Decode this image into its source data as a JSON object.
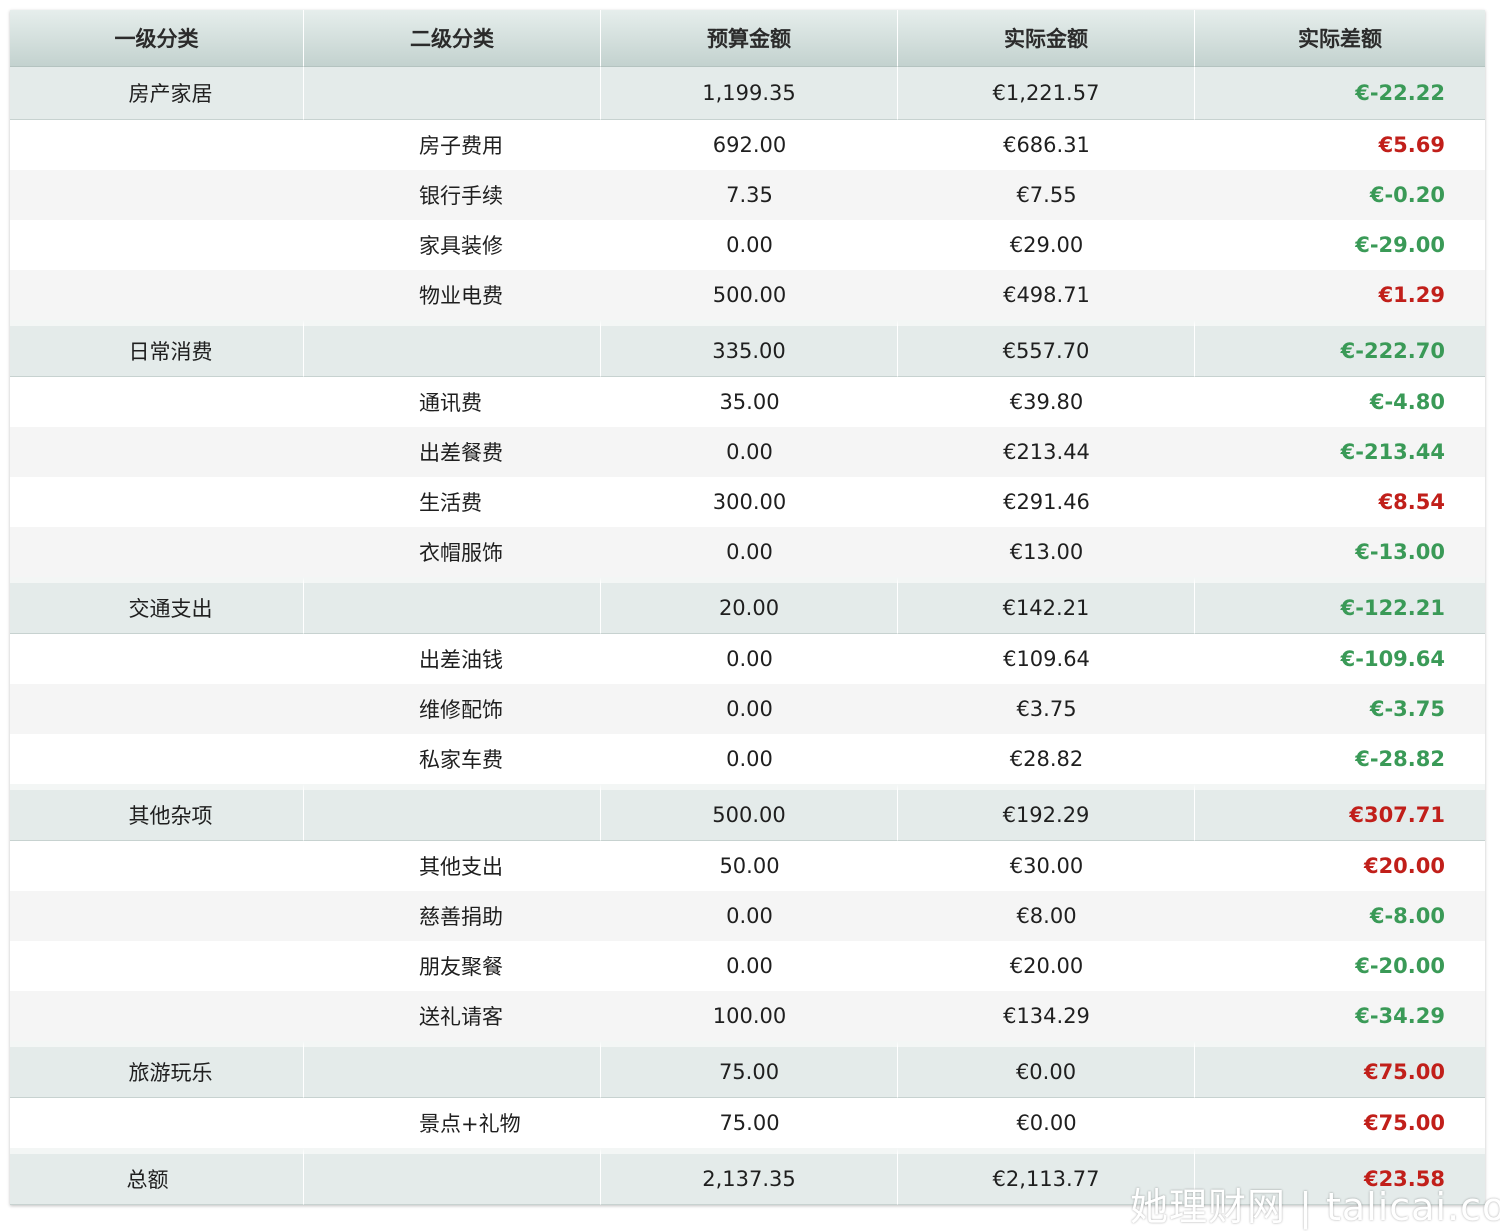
{
  "headers": [
    "一级分类",
    "二级分类",
    "预算金额",
    "实际金额",
    "实际差额"
  ],
  "groups": [
    {
      "name": "房产家居",
      "budget": "1,199.35",
      "actual": "€1,221.57",
      "diff": "€-22.22",
      "diff_sign": "neg",
      "items": [
        {
          "name": "房子费用",
          "budget": "692.00",
          "actual": "€686.31",
          "diff": "€5.69",
          "diff_sign": "pos"
        },
        {
          "name": "银行手续",
          "budget": "7.35",
          "actual": "€7.55",
          "diff": "€-0.20",
          "diff_sign": "neg"
        },
        {
          "name": "家具装修",
          "budget": "0.00",
          "actual": "€29.00",
          "diff": "€-29.00",
          "diff_sign": "neg"
        },
        {
          "name": "物业电费",
          "budget": "500.00",
          "actual": "€498.71",
          "diff": "€1.29",
          "diff_sign": "pos"
        }
      ]
    },
    {
      "name": "日常消费",
      "budget": "335.00",
      "actual": "€557.70",
      "diff": "€-222.70",
      "diff_sign": "neg",
      "items": [
        {
          "name": "通讯费",
          "budget": "35.00",
          "actual": "€39.80",
          "diff": "€-4.80",
          "diff_sign": "neg"
        },
        {
          "name": "出差餐费",
          "budget": "0.00",
          "actual": "€213.44",
          "diff": "€-213.44",
          "diff_sign": "neg"
        },
        {
          "name": "生活费",
          "budget": "300.00",
          "actual": "€291.46",
          "diff": "€8.54",
          "diff_sign": "pos"
        },
        {
          "name": "衣帽服饰",
          "budget": "0.00",
          "actual": "€13.00",
          "diff": "€-13.00",
          "diff_sign": "neg"
        }
      ]
    },
    {
      "name": "交通支出",
      "budget": "20.00",
      "actual": "€142.21",
      "diff": "€-122.21",
      "diff_sign": "neg",
      "items": [
        {
          "name": "出差油钱",
          "budget": "0.00",
          "actual": "€109.64",
          "diff": "€-109.64",
          "diff_sign": "neg"
        },
        {
          "name": "维修配饰",
          "budget": "0.00",
          "actual": "€3.75",
          "diff": "€-3.75",
          "diff_sign": "neg"
        },
        {
          "name": "私家车费",
          "budget": "0.00",
          "actual": "€28.82",
          "diff": "€-28.82",
          "diff_sign": "neg"
        }
      ]
    },
    {
      "name": "其他杂项",
      "budget": "500.00",
      "actual": "€192.29",
      "diff": "€307.71",
      "diff_sign": "pos",
      "items": [
        {
          "name": "其他支出",
          "budget": "50.00",
          "actual": "€30.00",
          "diff": "€20.00",
          "diff_sign": "pos"
        },
        {
          "name": "慈善捐助",
          "budget": "0.00",
          "actual": "€8.00",
          "diff": "€-8.00",
          "diff_sign": "neg"
        },
        {
          "name": "朋友聚餐",
          "budget": "0.00",
          "actual": "€20.00",
          "diff": "€-20.00",
          "diff_sign": "neg"
        },
        {
          "name": "送礼请客",
          "budget": "100.00",
          "actual": "€134.29",
          "diff": "€-34.29",
          "diff_sign": "neg"
        }
      ]
    },
    {
      "name": "旅游玩乐",
      "budget": "75.00",
      "actual": "€0.00",
      "diff": "€75.00",
      "diff_sign": "pos",
      "items": [
        {
          "name": "景点+礼物",
          "budget": "75.00",
          "actual": "€0.00",
          "diff": "€75.00",
          "diff_sign": "pos"
        }
      ]
    }
  ],
  "total": {
    "name": "总额",
    "budget": "2,137.35",
    "actual": "€2,113.77",
    "diff": "€23.58",
    "diff_sign": "pos"
  },
  "colors": {
    "negative_diff": "#3a9a57",
    "positive_diff": "#c11f1a",
    "header_bg": "#c3d2cf",
    "category_bg": "#e4ebea"
  },
  "watermark": "她理财网 | talicai.com"
}
